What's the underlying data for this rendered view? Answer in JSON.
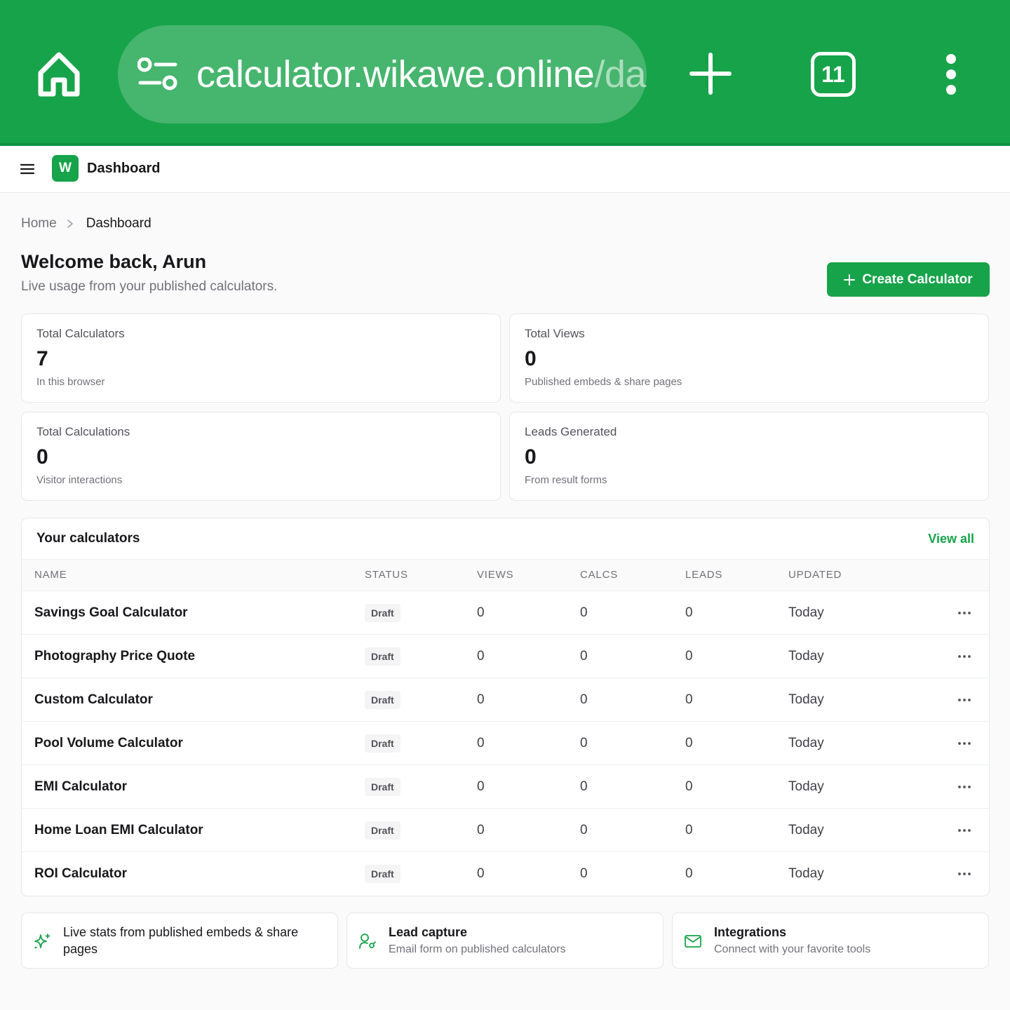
{
  "browser": {
    "url_main": "calculator.wikawe.online",
    "url_tail": "/da",
    "tab_count": "11"
  },
  "app": {
    "logo_letter": "W",
    "title": "Dashboard"
  },
  "breadcrumb": {
    "home": "Home",
    "current": "Dashboard"
  },
  "welcome": {
    "title": "Welcome back, Arun",
    "subtitle": "Live usage from your published calculators."
  },
  "actions": {
    "create_label": "Create Calculator"
  },
  "stats": [
    {
      "label": "Total Calculators",
      "value": "7",
      "hint": "In this browser"
    },
    {
      "label": "Total Views",
      "value": "0",
      "hint": "Published embeds & share pages"
    },
    {
      "label": "Total Calculations",
      "value": "0",
      "hint": "Visitor interactions"
    },
    {
      "label": "Leads Generated",
      "value": "0",
      "hint": "From result forms"
    }
  ],
  "table": {
    "title": "Your calculators",
    "view_all": "View all",
    "columns": {
      "name": "NAME",
      "status": "STATUS",
      "views": "VIEWS",
      "calcs": "CALCS",
      "leads": "LEADS",
      "updated": "UPDATED"
    },
    "rows": [
      {
        "name": "Savings Goal Calculator",
        "status": "Draft",
        "views": "0",
        "calcs": "0",
        "leads": "0",
        "updated": "Today"
      },
      {
        "name": "Photography Price Quote",
        "status": "Draft",
        "views": "0",
        "calcs": "0",
        "leads": "0",
        "updated": "Today"
      },
      {
        "name": "Custom Calculator",
        "status": "Draft",
        "views": "0",
        "calcs": "0",
        "leads": "0",
        "updated": "Today"
      },
      {
        "name": "Pool Volume Calculator",
        "status": "Draft",
        "views": "0",
        "calcs": "0",
        "leads": "0",
        "updated": "Today"
      },
      {
        "name": "EMI Calculator",
        "status": "Draft",
        "views": "0",
        "calcs": "0",
        "leads": "0",
        "updated": "Today"
      },
      {
        "name": "Home Loan EMI Calculator",
        "status": "Draft",
        "views": "0",
        "calcs": "0",
        "leads": "0",
        "updated": "Today"
      },
      {
        "name": "ROI Calculator",
        "status": "Draft",
        "views": "0",
        "calcs": "0",
        "leads": "0",
        "updated": "Today"
      }
    ]
  },
  "features": [
    {
      "icon": "sparkles-icon",
      "title": "Live stats from published embeds & share pages"
    },
    {
      "icon": "user-key-icon",
      "title": "Lead capture",
      "desc": "Email form on published calculators"
    },
    {
      "icon": "mail-icon",
      "title": "Integrations",
      "desc": "Connect with your favorite tools"
    }
  ],
  "colors": {
    "brand": "#17a34a",
    "chrome": "#17a34a"
  }
}
